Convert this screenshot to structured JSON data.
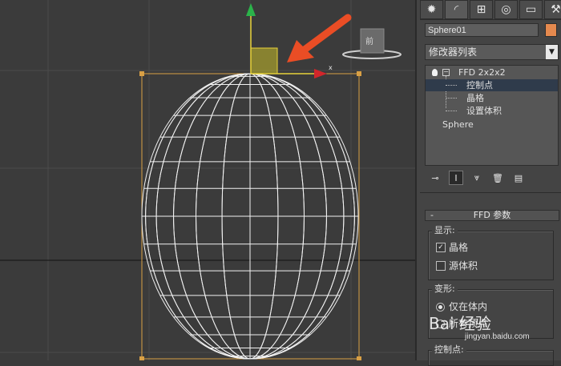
{
  "viewport": {
    "axis_label_x": "x",
    "viewcube_label": "前"
  },
  "panel": {
    "tabs": [
      {
        "icon": "create-icon",
        "glyph": "✹"
      },
      {
        "icon": "modify-icon",
        "glyph": "◜"
      },
      {
        "icon": "hierarchy-icon",
        "glyph": "⊞"
      },
      {
        "icon": "motion-icon",
        "glyph": "◎"
      },
      {
        "icon": "display-icon",
        "glyph": "▭"
      },
      {
        "icon": "utilities-icon",
        "glyph": "⚒"
      }
    ],
    "object_name": "Sphere01",
    "object_color": "#e5894e",
    "modifier_list_label": "修改器列表",
    "stack": {
      "items": [
        {
          "label": "FFD 2x2x2"
        },
        {
          "label": "控制点"
        },
        {
          "label": "晶格"
        },
        {
          "label": "设置体积"
        },
        {
          "label": "Sphere"
        }
      ]
    },
    "stack_tools": [
      {
        "icon": "pin-stack-icon",
        "glyph": "⊸"
      },
      {
        "icon": "show-end-result-icon",
        "glyph": "Ι"
      },
      {
        "icon": "make-unique-icon",
        "glyph": "⩔"
      },
      {
        "icon": "remove-modifier-icon",
        "glyph": "🗑"
      },
      {
        "icon": "configure-modifier-sets-icon",
        "glyph": "▤"
      }
    ],
    "rollout": {
      "collapse_symbol": "-",
      "title": "FFD 参数",
      "display_group": {
        "title": "显示:",
        "checks": [
          {
            "label": "晶格",
            "checked": true,
            "mark": "✓"
          },
          {
            "label": "源体积",
            "checked": false,
            "mark": ""
          }
        ]
      },
      "deform_group": {
        "title": "变形:",
        "radios": [
          {
            "label": "仅在体内",
            "on": true
          },
          {
            "label": "所有顶点",
            "on": false
          }
        ]
      },
      "control_points_group": {
        "title": "控制点:"
      }
    }
  },
  "watermark": {
    "main": "Bai 经验",
    "sub": "jingyan.baidu.com"
  }
}
